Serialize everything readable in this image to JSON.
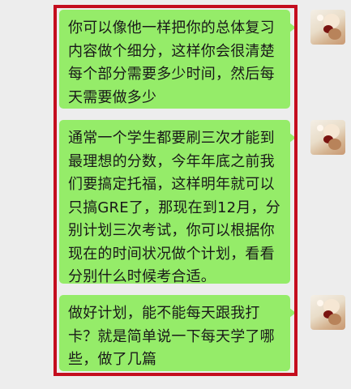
{
  "conversation": {
    "messages": [
      {
        "sender": "self",
        "text": "你可以像他一样把你的总体复习内容做个细分，这样你会很清楚每个部分需要多少时间，然后每天需要做多少"
      },
      {
        "sender": "self",
        "text": "通常一个学生都要刷三次才能到最理想的分数，今年年底之前我们要搞定托福，这样明年就可以只搞GRE了，那现在到12月，分别计划三次考试，你可以根据你现在的时间状况做个计划，看看分别什么时候考合适。"
      },
      {
        "sender": "self",
        "text": "做好计划，能不能每天跟我打卡？就是简单说一下每天学了哪些，做了几篇"
      }
    ]
  },
  "colors": {
    "bubble": "#95ec69",
    "background": "#ededed",
    "highlight": "#c40d1e"
  }
}
